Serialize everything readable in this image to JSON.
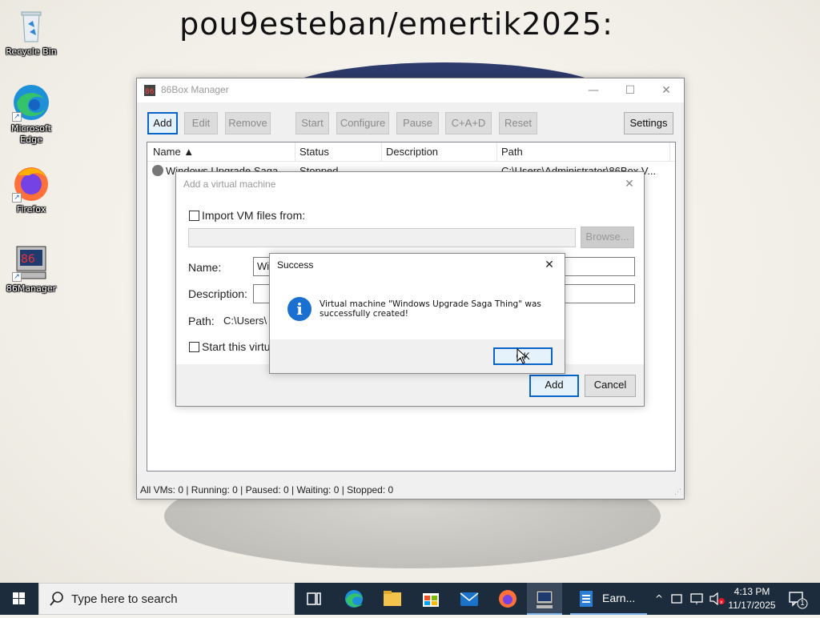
{
  "wallpaper": {
    "caption": "pou9esteban/emertik2025:"
  },
  "desktop_icons": [
    {
      "label": "Recycle Bin"
    },
    {
      "label": "Microsoft Edge"
    },
    {
      "label": "Firefox"
    },
    {
      "label": "86Manager"
    }
  ],
  "manager": {
    "title": "86Box Manager",
    "toolbar": {
      "add": "Add",
      "edit": "Edit",
      "remove": "Remove",
      "start": "Start",
      "configure": "Configure",
      "pause": "Pause",
      "cad": "C+A+D",
      "reset": "Reset",
      "settings": "Settings"
    },
    "columns": {
      "name": "Name ▲",
      "status": "Status",
      "description": "Description",
      "path": "Path"
    },
    "rows": [
      {
        "name": "Windows Upgrade Saga",
        "status": "Stopped",
        "description": "",
        "path": "C:\\Users\\Administrator\\86Box V..."
      }
    ],
    "status_bar": "All VMs: 0 | Running: 0 | Paused: 0 | Waiting: 0 | Stopped: 0"
  },
  "add_dialog": {
    "title": "Add a virtual machine",
    "import_label": "Import VM files from:",
    "import_path": "",
    "browse": "Browse...",
    "name_label": "Name:",
    "name_value": "Wi",
    "description_label": "Description:",
    "description_value": "",
    "path_label": "Path:",
    "path_value": "C:\\Users\\",
    "start_label": "Start this virtua",
    "add": "Add",
    "cancel": "Cancel"
  },
  "success_dialog": {
    "title": "Success",
    "message": "Virtual machine \"Windows Upgrade Saga Thing\" was successfully created!",
    "ok": "OK"
  },
  "taskbar": {
    "search_placeholder": "Type here to search",
    "active_app_label": "Earn...",
    "time": "4:13 PM",
    "date": "11/17/2025",
    "notification_count": "1"
  },
  "colors": {
    "accent": "#0a64c8",
    "taskbar": "#1c2c3c",
    "info_icon": "#1a6fd0"
  }
}
